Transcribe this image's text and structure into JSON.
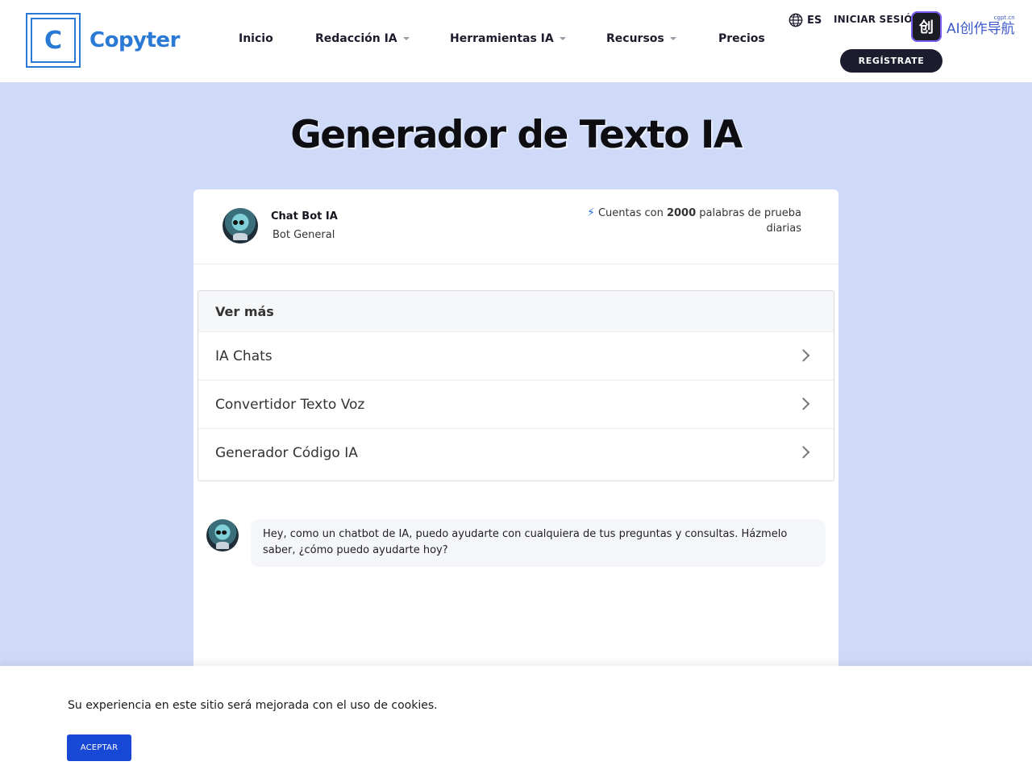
{
  "header": {
    "logo_letter": "C",
    "logo_text": "Copyter",
    "nav": [
      {
        "label": "Inicio",
        "dropdown": false
      },
      {
        "label": "Redacción IA",
        "dropdown": true
      },
      {
        "label": "Herramientas IA",
        "dropdown": true
      },
      {
        "label": "Recursos",
        "dropdown": true
      },
      {
        "label": "Precios",
        "dropdown": false
      }
    ],
    "language": "ES",
    "login_label": "INICIAR SESIÓN",
    "register_label": "REGÍSTRATE",
    "badge_icon_text": "创",
    "badge_text": "AI创作导航",
    "badge_sub": "cgpt.cn"
  },
  "main": {
    "title": "Generador de Texto IA",
    "bot": {
      "name": "Chat Bot IA",
      "subtitle": "Bot General",
      "credits_prefix": "Cuentas con ",
      "credits_number": "2000",
      "credits_suffix": " palabras de prueba diarias"
    },
    "more": {
      "heading": "Ver más",
      "items": [
        "IA Chats",
        "Convertidor Texto Voz",
        "Generador Código IA"
      ]
    },
    "message": "Hey, como un chatbot de IA, puedo ayudarte con cualquiera de tus preguntas y consultas. Házmelo saber, ¿cómo puedo ayudarte hoy?"
  },
  "cookie": {
    "text": "Su experiencia en este sitio será mejorada con el uso de cookies.",
    "accept_label": "ACEPTAR"
  },
  "colors": {
    "brand": "#2a7ad5",
    "background": "#cfdaf8",
    "register_bg": "#1b1d2e",
    "accept_bg": "#1748d6"
  }
}
